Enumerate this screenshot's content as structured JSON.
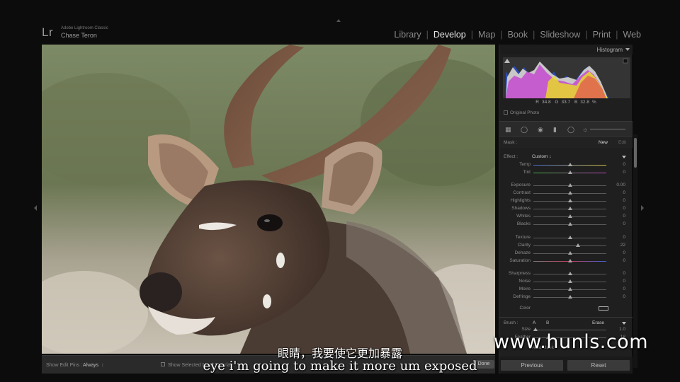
{
  "app": {
    "logo": "Lr",
    "name": "Adobe Lightroom Classic",
    "user": "Chase Teron"
  },
  "modules": [
    {
      "label": "Library",
      "active": false
    },
    {
      "label": "Develop",
      "active": true
    },
    {
      "label": "Map",
      "active": false
    },
    {
      "label": "Book",
      "active": false
    },
    {
      "label": "Slideshow",
      "active": false
    },
    {
      "label": "Print",
      "active": false
    },
    {
      "label": "Web",
      "active": false
    }
  ],
  "histogram": {
    "title": "Histogram",
    "r_label": "R",
    "r_value": "34.8",
    "g_label": "G",
    "g_value": "33.7",
    "b_label": "B",
    "b_value": "32.8",
    "unit": "%",
    "original_photo_label": "Original Photo"
  },
  "mask": {
    "label": "Mask :",
    "new_label": "New",
    "edit_label": "Edit"
  },
  "effect": {
    "label": "Effect :",
    "value": "Custom",
    "value_arrow": "↕"
  },
  "sliders": [
    {
      "label": "Temp",
      "value": "0",
      "pos": 0.5,
      "track": "temp"
    },
    {
      "label": "Tint",
      "value": "0",
      "pos": 0.5,
      "track": "tint"
    },
    {
      "label": "Exposure",
      "value": "0.00",
      "pos": 0.5,
      "track": "plain"
    },
    {
      "label": "Contrast",
      "value": "0",
      "pos": 0.5,
      "track": "plain"
    },
    {
      "label": "Highlights",
      "value": "0",
      "pos": 0.5,
      "track": "plain"
    },
    {
      "label": "Shadows",
      "value": "0",
      "pos": 0.5,
      "track": "plain"
    },
    {
      "label": "Whites",
      "value": "0",
      "pos": 0.5,
      "track": "plain"
    },
    {
      "label": "Blacks",
      "value": "0",
      "pos": 0.5,
      "track": "plain"
    },
    {
      "label": "Texture",
      "value": "0",
      "pos": 0.5,
      "track": "plain"
    },
    {
      "label": "Clarity",
      "value": "22",
      "pos": 0.61,
      "track": "plain"
    },
    {
      "label": "Dehaze",
      "value": "0",
      "pos": 0.5,
      "track": "plain"
    },
    {
      "label": "Saturation",
      "value": "0",
      "pos": 0.5,
      "track": "saturation"
    },
    {
      "label": "Sharpness",
      "value": "0",
      "pos": 0.5,
      "track": "plain"
    },
    {
      "label": "Noise",
      "value": "0",
      "pos": 0.5,
      "track": "plain"
    },
    {
      "label": "Moire",
      "value": "0",
      "pos": 0.5,
      "track": "plain"
    },
    {
      "label": "Defringe",
      "value": "0",
      "pos": 0.5,
      "track": "plain"
    }
  ],
  "color_label": "Color",
  "brush": {
    "label": "Brush :",
    "a": "A",
    "b": "B",
    "erase": "Erase",
    "size_label": "Size",
    "size_value": "1.0",
    "feather_label": "Feather",
    "feather_value": "18",
    "auto_mask_label": "Auto Mask"
  },
  "toolbar": {
    "edit_pins_label": "Show Edit Pins :",
    "edit_pins_value": "Always",
    "mask_overlay_label": "Show Selected Mask Overlay",
    "done_label": "Done"
  },
  "buttons": {
    "previous": "Previous",
    "reset": "Reset"
  },
  "subtitles": {
    "chinese": "眼睛，我要使它更加暴露",
    "english": "eye i'm going to make it more um exposed"
  },
  "watermark": "www.hunls.com",
  "colors": {
    "background": "#0c0c0c",
    "panel": "#1f1f1f",
    "active_module": "#e8e8e8",
    "inactive_module": "#8a8a8a"
  }
}
